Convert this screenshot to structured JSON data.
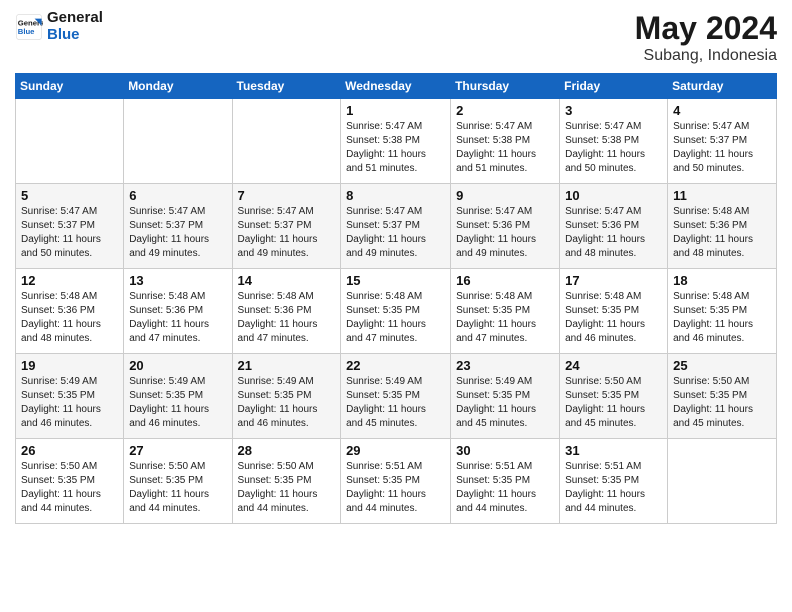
{
  "header": {
    "logo_line1": "General",
    "logo_line2": "Blue",
    "month_year": "May 2024",
    "location": "Subang, Indonesia"
  },
  "weekdays": [
    "Sunday",
    "Monday",
    "Tuesday",
    "Wednesday",
    "Thursday",
    "Friday",
    "Saturday"
  ],
  "weeks": [
    [
      {
        "day": "",
        "info": ""
      },
      {
        "day": "",
        "info": ""
      },
      {
        "day": "",
        "info": ""
      },
      {
        "day": "1",
        "info": "Sunrise: 5:47 AM\nSunset: 5:38 PM\nDaylight: 11 hours\nand 51 minutes."
      },
      {
        "day": "2",
        "info": "Sunrise: 5:47 AM\nSunset: 5:38 PM\nDaylight: 11 hours\nand 51 minutes."
      },
      {
        "day": "3",
        "info": "Sunrise: 5:47 AM\nSunset: 5:38 PM\nDaylight: 11 hours\nand 50 minutes."
      },
      {
        "day": "4",
        "info": "Sunrise: 5:47 AM\nSunset: 5:37 PM\nDaylight: 11 hours\nand 50 minutes."
      }
    ],
    [
      {
        "day": "5",
        "info": "Sunrise: 5:47 AM\nSunset: 5:37 PM\nDaylight: 11 hours\nand 50 minutes."
      },
      {
        "day": "6",
        "info": "Sunrise: 5:47 AM\nSunset: 5:37 PM\nDaylight: 11 hours\nand 49 minutes."
      },
      {
        "day": "7",
        "info": "Sunrise: 5:47 AM\nSunset: 5:37 PM\nDaylight: 11 hours\nand 49 minutes."
      },
      {
        "day": "8",
        "info": "Sunrise: 5:47 AM\nSunset: 5:37 PM\nDaylight: 11 hours\nand 49 minutes."
      },
      {
        "day": "9",
        "info": "Sunrise: 5:47 AM\nSunset: 5:36 PM\nDaylight: 11 hours\nand 49 minutes."
      },
      {
        "day": "10",
        "info": "Sunrise: 5:47 AM\nSunset: 5:36 PM\nDaylight: 11 hours\nand 48 minutes."
      },
      {
        "day": "11",
        "info": "Sunrise: 5:48 AM\nSunset: 5:36 PM\nDaylight: 11 hours\nand 48 minutes."
      }
    ],
    [
      {
        "day": "12",
        "info": "Sunrise: 5:48 AM\nSunset: 5:36 PM\nDaylight: 11 hours\nand 48 minutes."
      },
      {
        "day": "13",
        "info": "Sunrise: 5:48 AM\nSunset: 5:36 PM\nDaylight: 11 hours\nand 47 minutes."
      },
      {
        "day": "14",
        "info": "Sunrise: 5:48 AM\nSunset: 5:36 PM\nDaylight: 11 hours\nand 47 minutes."
      },
      {
        "day": "15",
        "info": "Sunrise: 5:48 AM\nSunset: 5:35 PM\nDaylight: 11 hours\nand 47 minutes."
      },
      {
        "day": "16",
        "info": "Sunrise: 5:48 AM\nSunset: 5:35 PM\nDaylight: 11 hours\nand 47 minutes."
      },
      {
        "day": "17",
        "info": "Sunrise: 5:48 AM\nSunset: 5:35 PM\nDaylight: 11 hours\nand 46 minutes."
      },
      {
        "day": "18",
        "info": "Sunrise: 5:48 AM\nSunset: 5:35 PM\nDaylight: 11 hours\nand 46 minutes."
      }
    ],
    [
      {
        "day": "19",
        "info": "Sunrise: 5:49 AM\nSunset: 5:35 PM\nDaylight: 11 hours\nand 46 minutes."
      },
      {
        "day": "20",
        "info": "Sunrise: 5:49 AM\nSunset: 5:35 PM\nDaylight: 11 hours\nand 46 minutes."
      },
      {
        "day": "21",
        "info": "Sunrise: 5:49 AM\nSunset: 5:35 PM\nDaylight: 11 hours\nand 46 minutes."
      },
      {
        "day": "22",
        "info": "Sunrise: 5:49 AM\nSunset: 5:35 PM\nDaylight: 11 hours\nand 45 minutes."
      },
      {
        "day": "23",
        "info": "Sunrise: 5:49 AM\nSunset: 5:35 PM\nDaylight: 11 hours\nand 45 minutes."
      },
      {
        "day": "24",
        "info": "Sunrise: 5:50 AM\nSunset: 5:35 PM\nDaylight: 11 hours\nand 45 minutes."
      },
      {
        "day": "25",
        "info": "Sunrise: 5:50 AM\nSunset: 5:35 PM\nDaylight: 11 hours\nand 45 minutes."
      }
    ],
    [
      {
        "day": "26",
        "info": "Sunrise: 5:50 AM\nSunset: 5:35 PM\nDaylight: 11 hours\nand 44 minutes."
      },
      {
        "day": "27",
        "info": "Sunrise: 5:50 AM\nSunset: 5:35 PM\nDaylight: 11 hours\nand 44 minutes."
      },
      {
        "day": "28",
        "info": "Sunrise: 5:50 AM\nSunset: 5:35 PM\nDaylight: 11 hours\nand 44 minutes."
      },
      {
        "day": "29",
        "info": "Sunrise: 5:51 AM\nSunset: 5:35 PM\nDaylight: 11 hours\nand 44 minutes."
      },
      {
        "day": "30",
        "info": "Sunrise: 5:51 AM\nSunset: 5:35 PM\nDaylight: 11 hours\nand 44 minutes."
      },
      {
        "day": "31",
        "info": "Sunrise: 5:51 AM\nSunset: 5:35 PM\nDaylight: 11 hours\nand 44 minutes."
      },
      {
        "day": "",
        "info": ""
      }
    ]
  ]
}
